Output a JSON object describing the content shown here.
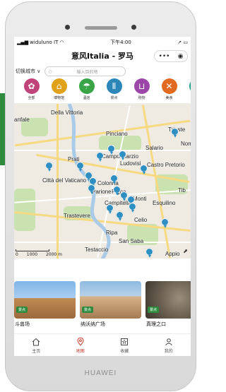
{
  "device": {
    "brand": "HUAWEI"
  },
  "status_bar": {
    "carrier": "widuluno IT",
    "time": "下午4:00"
  },
  "header": {
    "title": "意风Italia - 罗马",
    "more_icon": "ellipsis-icon",
    "close_icon": "target-icon"
  },
  "city_selector": {
    "label": "切换城市"
  },
  "search": {
    "placeholder": "输入目的地"
  },
  "categories": [
    {
      "label": "全部",
      "icon": "flower-icon",
      "color": "#c0437a"
    },
    {
      "label": "博物馆",
      "icon": "museum-icon",
      "color": "#e0a21a"
    },
    {
      "label": "酒店",
      "icon": "shell-icon",
      "color": "#3aa547"
    },
    {
      "label": "景点",
      "icon": "column-icon",
      "color": "#2c87b8"
    },
    {
      "label": "购物",
      "icon": "basket-icon",
      "color": "#9b46a8"
    },
    {
      "label": "美食",
      "icon": "cutlery-icon",
      "color": "#e06a1f"
    },
    {
      "label": "交通",
      "icon": "column-icon",
      "color": "#1fa38a"
    }
  ],
  "map": {
    "labels": [
      "Della Vittoria",
      "Pinciano",
      "Trieste",
      "Nom",
      "Salario",
      "Prati",
      "Campo Marzio",
      "Ludovisi",
      "Castro Pretorio",
      "Città del Vaticano",
      "Colonna",
      "Parione",
      "Pigna",
      "Tib",
      "Monti",
      "Esquilino",
      "Campitelli",
      "Trastevere",
      "Celio",
      "Ripa",
      "San Saba",
      "Testaccio",
      "Appio",
      "anfale"
    ],
    "scale_labels": [
      "0",
      "1000",
      "2000 m"
    ]
  },
  "cards": [
    {
      "tag": "景点",
      "name": "斗兽场"
    },
    {
      "tag": "景点",
      "name": "纳沃纳广场"
    },
    {
      "tag": "景点",
      "name": "真理之口"
    }
  ],
  "tabbar": [
    {
      "label": "主页",
      "icon": "home-icon"
    },
    {
      "label": "地图",
      "icon": "map-pin-icon"
    },
    {
      "label": "收藏",
      "icon": "star-icon"
    },
    {
      "label": "我的",
      "icon": "user-icon"
    }
  ]
}
